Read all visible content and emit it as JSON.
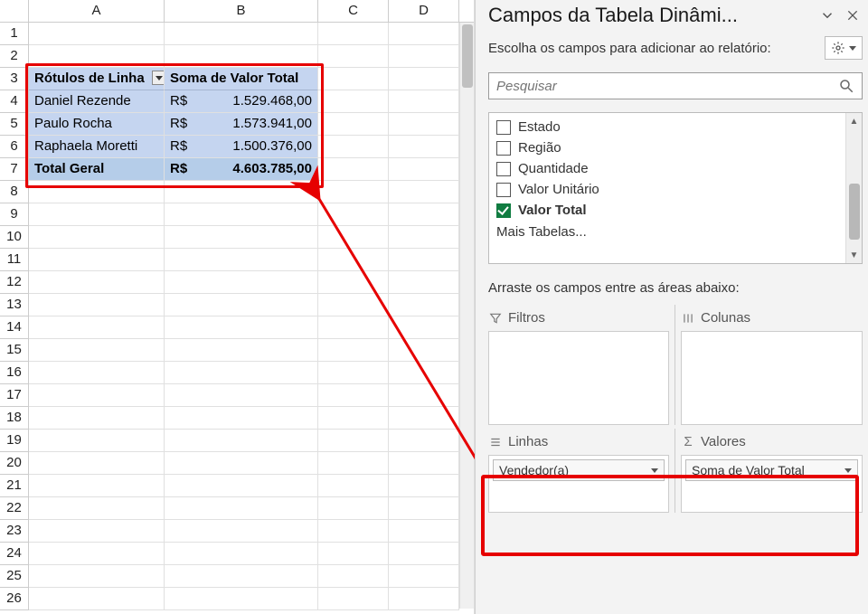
{
  "sheet": {
    "columns": [
      "A",
      "B",
      "C",
      "D"
    ],
    "rowCount": 26
  },
  "pivot": {
    "header1": "Rótulos de Linha",
    "header2": "Soma de Valor Total",
    "rows": [
      {
        "label": "Daniel Rezende",
        "cur": "R$",
        "val": "1.529.468,00"
      },
      {
        "label": "Paulo Rocha",
        "cur": "R$",
        "val": "1.573.941,00"
      },
      {
        "label": "Raphaela Moretti",
        "cur": "R$",
        "val": "1.500.376,00"
      }
    ],
    "totalLabel": "Total Geral",
    "totalCur": "R$",
    "totalVal": "4.603.785,00"
  },
  "pane": {
    "title": "Campos da Tabela Dinâmi...",
    "chooseText": "Escolha os campos para adicionar ao relatório:",
    "searchPlaceholder": "Pesquisar",
    "fields": {
      "f0": "Estado",
      "f1": "Região",
      "f2": "Quantidade",
      "f3": "Valor Unitário",
      "f4": "Valor Total"
    },
    "moreTables": "Mais Tabelas...",
    "dragText": "Arraste os campos entre as áreas abaixo:",
    "areas": {
      "filtros": "Filtros",
      "colunas": "Colunas",
      "linhas": "Linhas",
      "valores": "Valores"
    },
    "pillRow": "Vendedor(a)",
    "pillVal": "Soma de Valor Total"
  }
}
